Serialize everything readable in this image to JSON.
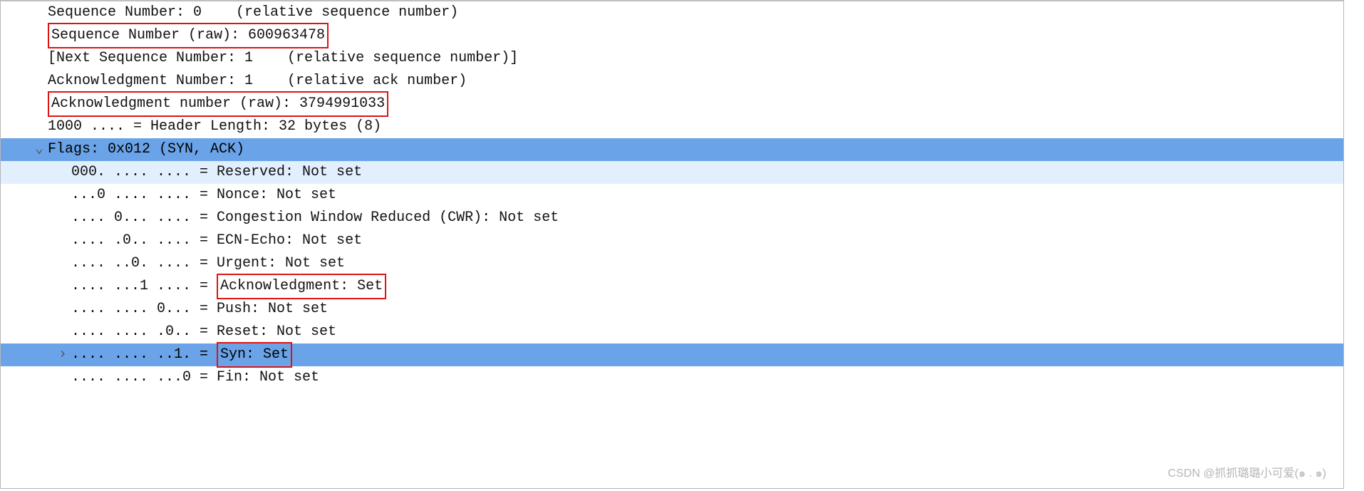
{
  "lines": {
    "seq_rel": "Sequence Number: 0    (relative sequence number)",
    "seq_raw": "Sequence Number (raw): 600963478",
    "next_seq": "[Next Sequence Number: 1    (relative sequence number)]",
    "ack_rel": "Acknowledgment Number: 1    (relative ack number)",
    "ack_raw": "Acknowledgment number (raw): 3794991033",
    "hdr_len": "1000 .... = Header Length: 32 bytes (8)",
    "flags_summary": "Flags: 0x012 (SYN, ACK)",
    "reserved": "000. .... .... = Reserved: Not set",
    "nonce": "...0 .... .... = Nonce: Not set",
    "cwr": ".... 0... .... = Congestion Window Reduced (CWR): Not set",
    "ecn": ".... .0.. .... = ECN-Echo: Not set",
    "urg": ".... ..0. .... = Urgent: Not set",
    "ack_bits": ".... ...1 .... = ",
    "ack_label": "Acknowledgment: Set",
    "push": ".... .... 0... = Push: Not set",
    "reset": ".... .... .0.. = Reset: Not set",
    "syn_bits": ".... .... ..1. = ",
    "syn_label": "Syn: Set",
    "fin": ".... .... ...0 = Fin: Not set"
  },
  "carets": {
    "down": "⌄",
    "right": "›"
  },
  "watermark": "CSDN @抓抓璐璐小可爱(๑ . ๑)"
}
